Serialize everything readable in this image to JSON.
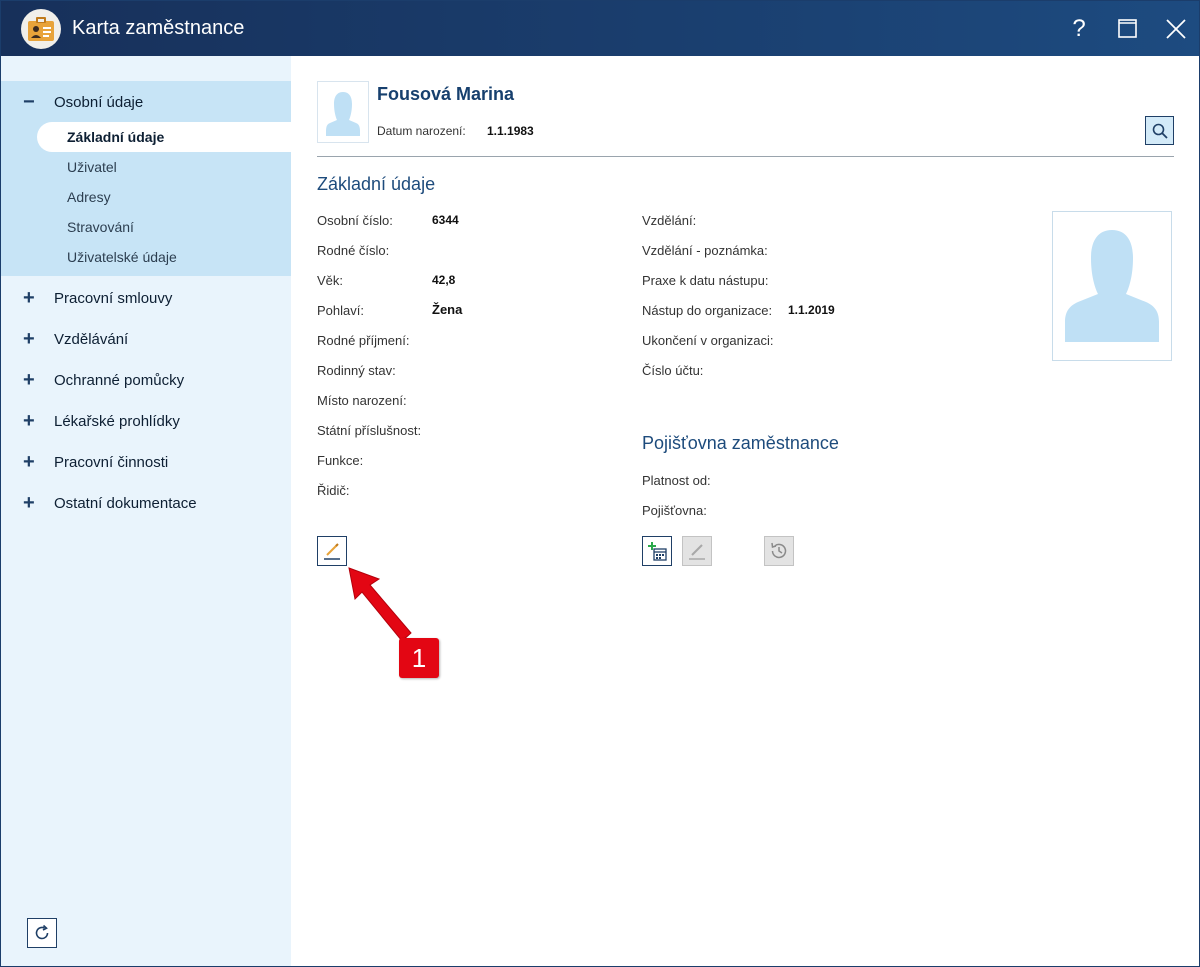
{
  "window": {
    "title": "Karta zaměstnance",
    "help_label": "?"
  },
  "sidebar": {
    "sections": [
      {
        "label": "Osobní údaje",
        "sign": "−",
        "expanded": true,
        "items": [
          {
            "label": "Základní údaje",
            "active": true
          },
          {
            "label": "Uživatel"
          },
          {
            "label": "Adresy"
          },
          {
            "label": "Stravování"
          },
          {
            "label": "Uživatelské údaje"
          }
        ]
      },
      {
        "label": "Pracovní smlouvy",
        "sign": "+"
      },
      {
        "label": "Vzdělávání",
        "sign": "+"
      },
      {
        "label": "Ochranné pomůcky",
        "sign": "+"
      },
      {
        "label": "Lékařské prohlídky",
        "sign": "+"
      },
      {
        "label": "Pracovní činnosti",
        "sign": "+"
      },
      {
        "label": "Ostatní dokumentace",
        "sign": "+"
      }
    ],
    "refresh_icon": "refresh-icon"
  },
  "header": {
    "name": "Fousová Marina",
    "dob_label": "Datum narození:",
    "dob_value": "1.1.1983",
    "search_icon": "search-icon"
  },
  "basic": {
    "title": "Základní údaje",
    "left_fields": [
      {
        "label": "Osobní číslo:",
        "value": "6344"
      },
      {
        "label": "Rodné číslo:",
        "value": ""
      },
      {
        "label": "Věk:",
        "value": "42,8"
      },
      {
        "label": "Pohlaví:",
        "value": "Žena"
      },
      {
        "label": "Rodné příjmení:",
        "value": ""
      },
      {
        "label": "Rodinný stav:",
        "value": ""
      },
      {
        "label": "Místo narození:",
        "value": ""
      },
      {
        "label": "Státní příslušnost:",
        "value": ""
      },
      {
        "label": "Funkce:",
        "value": ""
      },
      {
        "label": "Řidič:",
        "value": ""
      }
    ],
    "right_fields": [
      {
        "label": "Vzdělání:",
        "value": ""
      },
      {
        "label": "Vzdělání - poznámka:",
        "value": ""
      },
      {
        "label": "Praxe k datu nástupu:",
        "value": ""
      },
      {
        "label": "Nástup do organizace:",
        "value": "1.1.2019"
      },
      {
        "label": "Ukončení v organizaci:",
        "value": ""
      },
      {
        "label": "Číslo účtu:",
        "value": ""
      }
    ]
  },
  "insurance": {
    "title": "Pojišťovna zaměstnance",
    "fields": [
      {
        "label": "Platnost od:",
        "value": ""
      },
      {
        "label": "Pojišťovna:",
        "value": ""
      }
    ]
  },
  "callout": {
    "number": "1"
  },
  "colors": {
    "title_bar": "#1a3e6e",
    "accent": "#1d4b7c",
    "sidebar_bg": "#e9f4fc",
    "sidebar_open_bg": "#c7e4f6",
    "callout_red": "#e30613"
  }
}
